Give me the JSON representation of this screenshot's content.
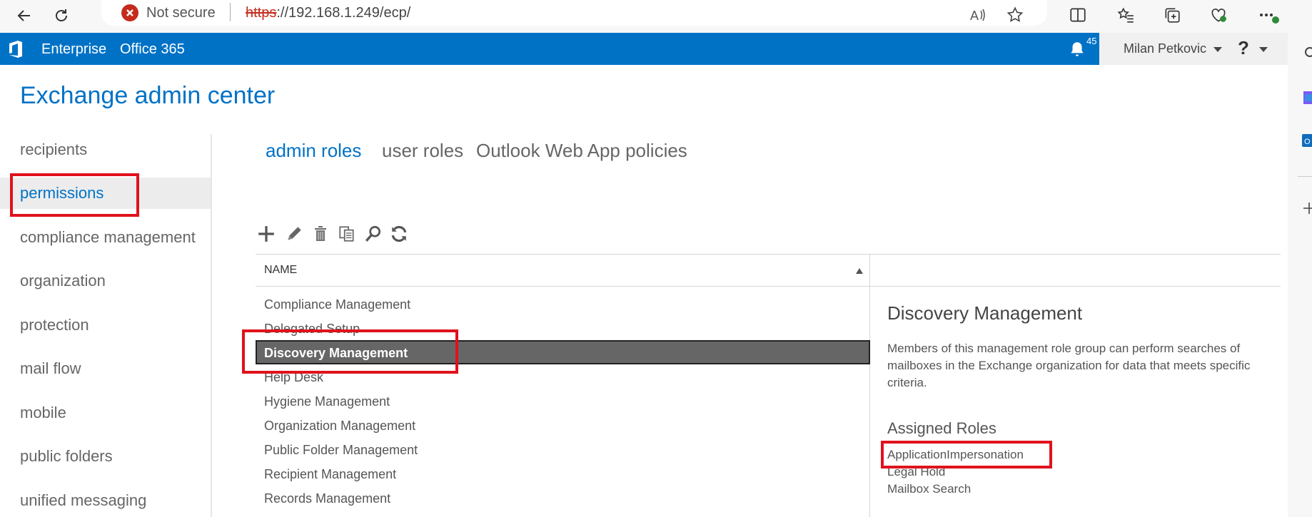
{
  "browser": {
    "security_label": "Not secure",
    "url_scheme": "https",
    "url_rest": "://192.168.1.249/ecp/"
  },
  "suite": {
    "tabs": [
      "Enterprise",
      "Office 365"
    ],
    "notification_count": "45",
    "user_name": "Milan Petkovic",
    "help_label": "?",
    "header_color": "#0072c6"
  },
  "app": {
    "title": "Exchange admin center"
  },
  "leftnav": {
    "items": [
      {
        "label": "recipients"
      },
      {
        "label": "permissions"
      },
      {
        "label": "compliance management"
      },
      {
        "label": "organization"
      },
      {
        "label": "protection"
      },
      {
        "label": "mail flow"
      },
      {
        "label": "mobile"
      },
      {
        "label": "public folders"
      },
      {
        "label": "unified messaging"
      }
    ],
    "selected": "permissions"
  },
  "pivots": [
    "admin roles",
    "user roles",
    "Outlook Web App policies"
  ],
  "toolbar": [
    "add-icon",
    "edit-icon",
    "delete-icon",
    "copy-icon",
    "search-icon",
    "refresh-icon"
  ],
  "list": {
    "column_header": "NAME",
    "rows": [
      "Compliance Management",
      "Delegated Setup",
      "Discovery Management",
      "Help Desk",
      "Hygiene Management",
      "Organization Management",
      "Public Folder Management",
      "Recipient Management",
      "Records Management"
    ],
    "selected": "Discovery Management"
  },
  "details": {
    "title": "Discovery Management",
    "description": "Members of this management role group can perform searches of mailboxes in the Exchange organization for data that meets specific criteria.",
    "assigned_roles_heading": "Assigned Roles",
    "assigned_roles": [
      "ApplicationImpersonation",
      "Legal Hold",
      "Mailbox Search"
    ]
  },
  "highlight_color": "#e0121c"
}
